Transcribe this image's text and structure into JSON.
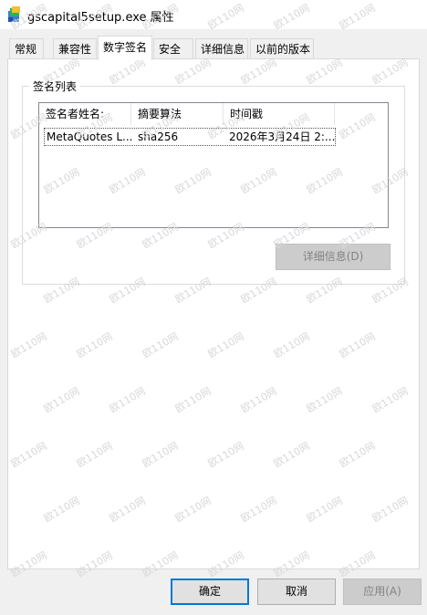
{
  "window": {
    "title": "gscapital5setup.exe 属性",
    "icon": "installer-app-icon"
  },
  "tabs": [
    {
      "label": "常规"
    },
    {
      "label": "兼容性"
    },
    {
      "label": "数字签名",
      "active": true
    },
    {
      "label": "安全"
    },
    {
      "label": "详细信息"
    },
    {
      "label": "以前的版本"
    }
  ],
  "signature_group": {
    "label": "签名列表",
    "columns": [
      "签名者姓名:",
      "摘要算法",
      "时间戳"
    ],
    "rows": [
      {
        "signer": "MetaQuotes L...",
        "digest": "sha256",
        "timestamp": "2026年3月24日 2:..."
      }
    ],
    "details_button": "详细信息(D)"
  },
  "footer": {
    "ok_label": "确定",
    "cancel_label": "取消",
    "apply_label": "应用(A)"
  },
  "watermark_text": "欧110网",
  "colors": {
    "accent": "#0078d7",
    "background": "#f0f0f0",
    "panel": "#ffffff"
  }
}
